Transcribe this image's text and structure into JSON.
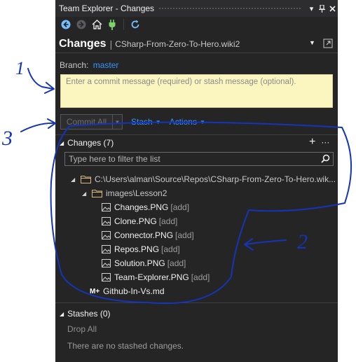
{
  "window": {
    "title": "Team Explorer - Changes"
  },
  "titlebar_icons": [
    "chevron-down-icon",
    "pin-icon",
    "close-icon"
  ],
  "toolbar": {
    "icons": [
      "back-icon",
      "forward-icon",
      "home-icon",
      "plug-icon",
      "refresh-icon"
    ]
  },
  "header": {
    "title": "Changes",
    "separator": "|",
    "repo": "CSharp-From-Zero-To-Hero.wiki2"
  },
  "branch": {
    "label": "Branch:",
    "name": "master"
  },
  "commit": {
    "placeholder": "Enter a commit message (required) or stash message (optional).",
    "commit_all": "Commit All",
    "stash": "Stash",
    "actions": "Actions"
  },
  "changes": {
    "header": "Changes (7)",
    "filter_placeholder": "Type here to filter the list",
    "root_path": "C:\\Users\\alman\\Source\\Repos\\CSharp-From-Zero-To-Hero.wik...",
    "folder": "images\\Lesson2",
    "files": [
      {
        "name": "Changes.PNG",
        "status": "[add]"
      },
      {
        "name": "Clone.PNG",
        "status": "[add]"
      },
      {
        "name": "Connector.PNG",
        "status": "[add]"
      },
      {
        "name": "Repos.PNG",
        "status": "[add]"
      },
      {
        "name": "Solution.PNG",
        "status": "[add]"
      },
      {
        "name": "Team-Explorer.PNG",
        "status": "[add]"
      }
    ],
    "md_badge": "M+",
    "md_file": "Github-In-Vs.md"
  },
  "stashes": {
    "header": "Stashes (0)",
    "drop_all": "Drop All",
    "empty_message": "There are no stashed changes."
  },
  "annotations": {
    "n1": "1",
    "n2": "2",
    "n3": "3"
  },
  "colors": {
    "panel_bg": "#252526",
    "link": "#3794ff",
    "commit_bg": "#fbf6bf",
    "annotation": "#1535b8"
  }
}
